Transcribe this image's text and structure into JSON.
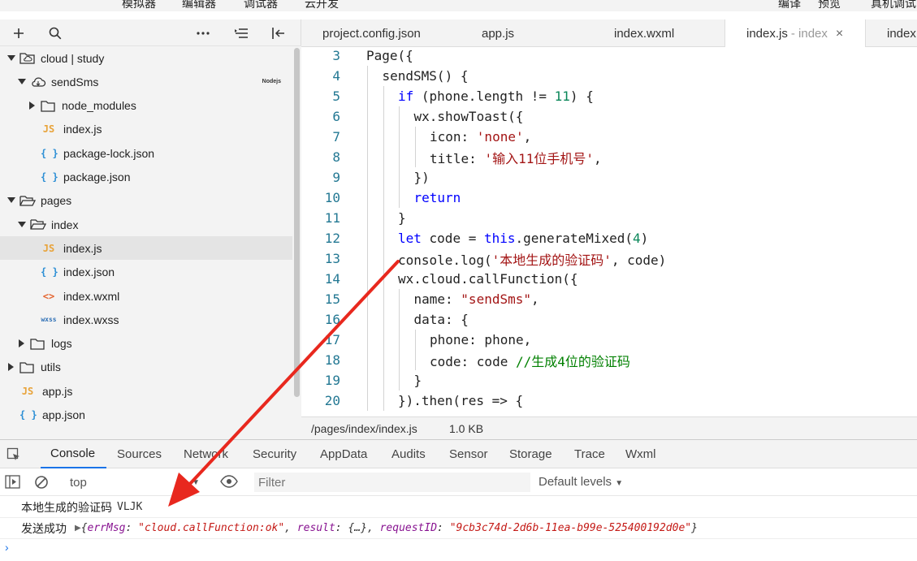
{
  "top_menu": [
    "模拟器",
    "编辑器",
    "调试器",
    "云开发",
    "编译",
    "预览",
    "真机调试"
  ],
  "left_toolbar": {
    "icons": [
      "plus-icon",
      "search-icon",
      "more-icon",
      "outdent-icon",
      "collapse-icon"
    ]
  },
  "tree": [
    {
      "label": "cloud | study",
      "depth": 0,
      "kind": "folder-cloud",
      "expanded": true
    },
    {
      "label": "sendSms",
      "depth": 1,
      "kind": "cloud-function",
      "expanded": true,
      "badge": "Nodejs"
    },
    {
      "label": "node_modules",
      "depth": 2,
      "kind": "folder",
      "expanded": false
    },
    {
      "label": "index.js",
      "depth": 2,
      "kind": "js"
    },
    {
      "label": "package-lock.json",
      "depth": 2,
      "kind": "json"
    },
    {
      "label": "package.json",
      "depth": 2,
      "kind": "json"
    },
    {
      "label": "pages",
      "depth": 0,
      "kind": "folder",
      "expanded": true
    },
    {
      "label": "index",
      "depth": 1,
      "kind": "folder",
      "expanded": true
    },
    {
      "label": "index.js",
      "depth": 2,
      "kind": "js",
      "selected": true
    },
    {
      "label": "index.json",
      "depth": 2,
      "kind": "json"
    },
    {
      "label": "index.wxml",
      "depth": 2,
      "kind": "wxml"
    },
    {
      "label": "index.wxss",
      "depth": 2,
      "kind": "wxss"
    },
    {
      "label": "logs",
      "depth": 1,
      "kind": "folder",
      "expanded": false
    },
    {
      "label": "utils",
      "depth": 0,
      "kind": "folder",
      "expanded": false
    },
    {
      "label": "app.js",
      "depth": 0,
      "kind": "js"
    },
    {
      "label": "app.json",
      "depth": 0,
      "kind": "json"
    }
  ],
  "file_icons": {
    "js": "JS",
    "json": "{ }",
    "wxml": "<>",
    "wxss": "wxss"
  },
  "editor_tabs": [
    {
      "label": "project.config.json"
    },
    {
      "label": "app.js"
    },
    {
      "label": "index.wxml"
    },
    {
      "label": "index.js",
      "sub": "- index",
      "close": "×",
      "active": true
    },
    {
      "label": "index"
    }
  ],
  "code_lines": [
    {
      "n": "3",
      "indent": 0,
      "tokens": [
        [
          "",
          "Page({"
        ]
      ]
    },
    {
      "n": "4",
      "indent": 1,
      "tokens": [
        [
          "",
          "sendSMS() {"
        ]
      ]
    },
    {
      "n": "5",
      "indent": 2,
      "tokens": [
        [
          "kw",
          "if"
        ],
        [
          "",
          " (phone.length != "
        ],
        [
          "num",
          "11"
        ],
        [
          "",
          ") {"
        ]
      ]
    },
    {
      "n": "6",
      "indent": 3,
      "tokens": [
        [
          "",
          "wx.showToast({"
        ]
      ]
    },
    {
      "n": "7",
      "indent": 4,
      "tokens": [
        [
          "",
          "icon: "
        ],
        [
          "str",
          "'none'"
        ],
        [
          "",
          ","
        ]
      ]
    },
    {
      "n": "8",
      "indent": 4,
      "tokens": [
        [
          "",
          "title: "
        ],
        [
          "str",
          "'输入11位手机号'"
        ],
        [
          "",
          ","
        ]
      ]
    },
    {
      "n": "9",
      "indent": 3,
      "tokens": [
        [
          "",
          "})"
        ]
      ]
    },
    {
      "n": "10",
      "indent": 3,
      "tokens": [
        [
          "kw",
          "return"
        ]
      ]
    },
    {
      "n": "11",
      "indent": 2,
      "tokens": [
        [
          "",
          "}"
        ]
      ]
    },
    {
      "n": "12",
      "indent": 2,
      "tokens": [
        [
          "kw",
          "let"
        ],
        [
          "",
          " code = "
        ],
        [
          "kw",
          "this"
        ],
        [
          "",
          ".generateMixed("
        ],
        [
          "num",
          "4"
        ],
        [
          "",
          ")"
        ]
      ]
    },
    {
      "n": "13",
      "indent": 2,
      "tokens": [
        [
          "",
          "console.log("
        ],
        [
          "str",
          "'本地生成的验证码'"
        ],
        [
          "",
          ", code)"
        ]
      ]
    },
    {
      "n": "14",
      "indent": 2,
      "tokens": [
        [
          "",
          "wx.cloud.callFunction({"
        ]
      ]
    },
    {
      "n": "15",
      "indent": 3,
      "tokens": [
        [
          "",
          "name: "
        ],
        [
          "str",
          "\"sendSms\""
        ],
        [
          "",
          ","
        ]
      ]
    },
    {
      "n": "16",
      "indent": 3,
      "tokens": [
        [
          "",
          "data: {"
        ]
      ]
    },
    {
      "n": "17",
      "indent": 4,
      "tokens": [
        [
          "",
          "phone: phone,"
        ]
      ]
    },
    {
      "n": "18",
      "indent": 4,
      "tokens": [
        [
          "",
          "code: code "
        ],
        [
          "cmt",
          "//生成4位的验证码"
        ]
      ]
    },
    {
      "n": "19",
      "indent": 3,
      "tokens": [
        [
          "",
          "}"
        ]
      ]
    },
    {
      "n": "20",
      "indent": 2,
      "tokens": [
        [
          "",
          "}).then(res => {"
        ]
      ]
    }
  ],
  "status_bar": {
    "path": "/pages/index/index.js",
    "size": "1.0 KB"
  },
  "devtools_tabs": [
    "Console",
    "Sources",
    "Network",
    "Security",
    "AppData",
    "Audits",
    "Sensor",
    "Storage",
    "Trace",
    "Wxml"
  ],
  "console_toolbar": {
    "context": "top",
    "filter_placeholder": "Filter",
    "levels": "Default levels"
  },
  "console_logs": {
    "line1_label": "本地生成的验证码",
    "line1_value": "VLJK",
    "line2_label": "发送成功",
    "line2_obj": {
      "open": "{",
      "k1": "errMsg",
      "v1": "\"cloud.callFunction:ok\"",
      "k2": "result",
      "v2": "{…}",
      "k3": "requestID",
      "v3": "\"9cb3c74d-2d6b-11ea-b99e-525400192d0e\"",
      "close": "}"
    }
  },
  "colors": {
    "annotation_arrow": "#e8281e",
    "active_tab_underline": "#1a73e8"
  }
}
